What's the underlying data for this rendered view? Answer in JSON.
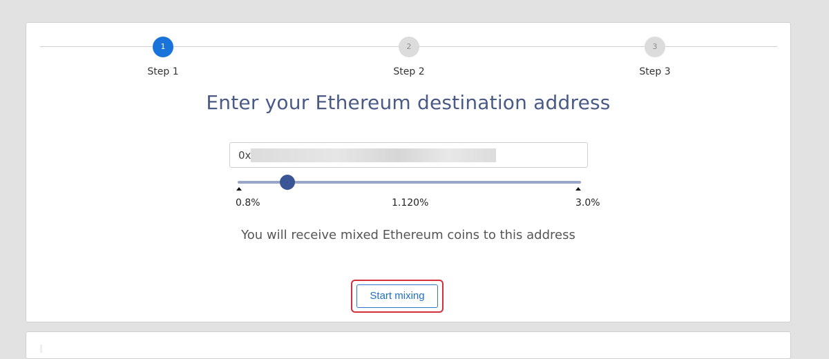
{
  "stepper": {
    "steps": [
      {
        "number": "1",
        "label": "Step 1",
        "active": true
      },
      {
        "number": "2",
        "label": "Step 2",
        "active": false
      },
      {
        "number": "3",
        "label": "Step 3",
        "active": false
      }
    ]
  },
  "form": {
    "heading": "Enter your Ethereum destination address",
    "address_prefix": "0x",
    "fee_slider": {
      "min_label": "0.8%",
      "value_label": "1.120%",
      "max_label": "3.0%",
      "min": 0.8,
      "max": 3.0,
      "value": 1.12
    },
    "info_text": "You will receive mixed Ethereum coins to this address",
    "start_button_label": "Start mixing"
  },
  "colors": {
    "active_step": "#1a73d9",
    "slider_handle": "#3a5594",
    "highlight": "#d42d3b",
    "button_text": "#1f6ec2"
  }
}
